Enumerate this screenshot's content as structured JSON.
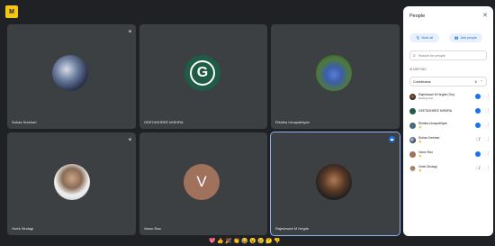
{
  "app": {
    "logo_glyph": "M"
  },
  "tiles": [
    {
      "name": "Suhas Sreehari",
      "mic": "Ψ"
    },
    {
      "name": "GEETASHREE MISHRA",
      "mic": "",
      "avatar_letter": "G"
    },
    {
      "name": "Rishika Umapathiyan",
      "mic": ""
    },
    {
      "name": "Vivek Sindagi",
      "mic": "Ψ"
    },
    {
      "name": "Varun Rao",
      "mic": "",
      "avatar_letter": "V"
    },
    {
      "name": "Rajeshwari M Hegde",
      "mic": ""
    }
  ],
  "reactions": [
    "💖",
    "👍",
    "🎉",
    "👏",
    "😂",
    "😮",
    "😢",
    "🤔",
    "👎"
  ],
  "panel": {
    "title": "People",
    "close_icon": "✕",
    "mute_all_label": "Mute all",
    "add_people_label": "Add people",
    "search_placeholder": "Search for people",
    "section_label": "IN MEETING",
    "contributors_label": "Contributors",
    "contributors_count": "6",
    "chevron": "⌃",
    "participants": [
      {
        "name": "Rajeshwari M Hegde (You)",
        "sub": "Meeting host",
        "hand": "",
        "mic": "on"
      },
      {
        "name": "GEETASHREE MISHRA",
        "sub": "",
        "hand": "",
        "mic": "on"
      },
      {
        "name": "Rishika Umapathiyan",
        "sub": "",
        "hand": "✋",
        "mic": "on"
      },
      {
        "name": "Suhas Sreehari",
        "sub": "",
        "hand": "✋",
        "mic": "off"
      },
      {
        "name": "Varun Rao",
        "sub": "",
        "hand": "✋",
        "mic": "on"
      },
      {
        "name": "Vivek Sindagi",
        "sub": "",
        "hand": "✋",
        "mic": "off"
      }
    ]
  },
  "colors": {
    "accent": "#1a73e8",
    "tile_bg": "#3c4043",
    "page_bg": "#202124"
  }
}
